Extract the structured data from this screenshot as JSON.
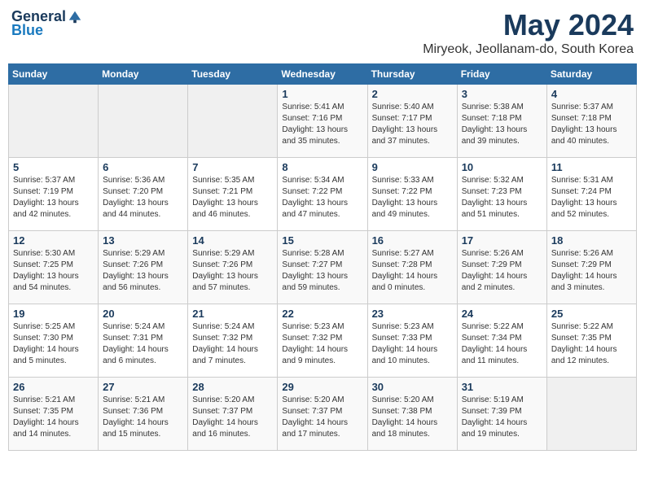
{
  "logo": {
    "general": "General",
    "blue": "Blue"
  },
  "header": {
    "month": "May 2024",
    "location": "Miryeok, Jeollanam-do, South Korea"
  },
  "weekdays": [
    "Sunday",
    "Monday",
    "Tuesday",
    "Wednesday",
    "Thursday",
    "Friday",
    "Saturday"
  ],
  "weeks": [
    [
      {
        "day": "",
        "info": ""
      },
      {
        "day": "",
        "info": ""
      },
      {
        "day": "",
        "info": ""
      },
      {
        "day": "1",
        "info": "Sunrise: 5:41 AM\nSunset: 7:16 PM\nDaylight: 13 hours\nand 35 minutes."
      },
      {
        "day": "2",
        "info": "Sunrise: 5:40 AM\nSunset: 7:17 PM\nDaylight: 13 hours\nand 37 minutes."
      },
      {
        "day": "3",
        "info": "Sunrise: 5:38 AM\nSunset: 7:18 PM\nDaylight: 13 hours\nand 39 minutes."
      },
      {
        "day": "4",
        "info": "Sunrise: 5:37 AM\nSunset: 7:18 PM\nDaylight: 13 hours\nand 40 minutes."
      }
    ],
    [
      {
        "day": "5",
        "info": "Sunrise: 5:37 AM\nSunset: 7:19 PM\nDaylight: 13 hours\nand 42 minutes."
      },
      {
        "day": "6",
        "info": "Sunrise: 5:36 AM\nSunset: 7:20 PM\nDaylight: 13 hours\nand 44 minutes."
      },
      {
        "day": "7",
        "info": "Sunrise: 5:35 AM\nSunset: 7:21 PM\nDaylight: 13 hours\nand 46 minutes."
      },
      {
        "day": "8",
        "info": "Sunrise: 5:34 AM\nSunset: 7:22 PM\nDaylight: 13 hours\nand 47 minutes."
      },
      {
        "day": "9",
        "info": "Sunrise: 5:33 AM\nSunset: 7:22 PM\nDaylight: 13 hours\nand 49 minutes."
      },
      {
        "day": "10",
        "info": "Sunrise: 5:32 AM\nSunset: 7:23 PM\nDaylight: 13 hours\nand 51 minutes."
      },
      {
        "day": "11",
        "info": "Sunrise: 5:31 AM\nSunset: 7:24 PM\nDaylight: 13 hours\nand 52 minutes."
      }
    ],
    [
      {
        "day": "12",
        "info": "Sunrise: 5:30 AM\nSunset: 7:25 PM\nDaylight: 13 hours\nand 54 minutes."
      },
      {
        "day": "13",
        "info": "Sunrise: 5:29 AM\nSunset: 7:26 PM\nDaylight: 13 hours\nand 56 minutes."
      },
      {
        "day": "14",
        "info": "Sunrise: 5:29 AM\nSunset: 7:26 PM\nDaylight: 13 hours\nand 57 minutes."
      },
      {
        "day": "15",
        "info": "Sunrise: 5:28 AM\nSunset: 7:27 PM\nDaylight: 13 hours\nand 59 minutes."
      },
      {
        "day": "16",
        "info": "Sunrise: 5:27 AM\nSunset: 7:28 PM\nDaylight: 14 hours\nand 0 minutes."
      },
      {
        "day": "17",
        "info": "Sunrise: 5:26 AM\nSunset: 7:29 PM\nDaylight: 14 hours\nand 2 minutes."
      },
      {
        "day": "18",
        "info": "Sunrise: 5:26 AM\nSunset: 7:29 PM\nDaylight: 14 hours\nand 3 minutes."
      }
    ],
    [
      {
        "day": "19",
        "info": "Sunrise: 5:25 AM\nSunset: 7:30 PM\nDaylight: 14 hours\nand 5 minutes."
      },
      {
        "day": "20",
        "info": "Sunrise: 5:24 AM\nSunset: 7:31 PM\nDaylight: 14 hours\nand 6 minutes."
      },
      {
        "day": "21",
        "info": "Sunrise: 5:24 AM\nSunset: 7:32 PM\nDaylight: 14 hours\nand 7 minutes."
      },
      {
        "day": "22",
        "info": "Sunrise: 5:23 AM\nSunset: 7:32 PM\nDaylight: 14 hours\nand 9 minutes."
      },
      {
        "day": "23",
        "info": "Sunrise: 5:23 AM\nSunset: 7:33 PM\nDaylight: 14 hours\nand 10 minutes."
      },
      {
        "day": "24",
        "info": "Sunrise: 5:22 AM\nSunset: 7:34 PM\nDaylight: 14 hours\nand 11 minutes."
      },
      {
        "day": "25",
        "info": "Sunrise: 5:22 AM\nSunset: 7:35 PM\nDaylight: 14 hours\nand 12 minutes."
      }
    ],
    [
      {
        "day": "26",
        "info": "Sunrise: 5:21 AM\nSunset: 7:35 PM\nDaylight: 14 hours\nand 14 minutes."
      },
      {
        "day": "27",
        "info": "Sunrise: 5:21 AM\nSunset: 7:36 PM\nDaylight: 14 hours\nand 15 minutes."
      },
      {
        "day": "28",
        "info": "Sunrise: 5:20 AM\nSunset: 7:37 PM\nDaylight: 14 hours\nand 16 minutes."
      },
      {
        "day": "29",
        "info": "Sunrise: 5:20 AM\nSunset: 7:37 PM\nDaylight: 14 hours\nand 17 minutes."
      },
      {
        "day": "30",
        "info": "Sunrise: 5:20 AM\nSunset: 7:38 PM\nDaylight: 14 hours\nand 18 minutes."
      },
      {
        "day": "31",
        "info": "Sunrise: 5:19 AM\nSunset: 7:39 PM\nDaylight: 14 hours\nand 19 minutes."
      },
      {
        "day": "",
        "info": ""
      }
    ]
  ]
}
